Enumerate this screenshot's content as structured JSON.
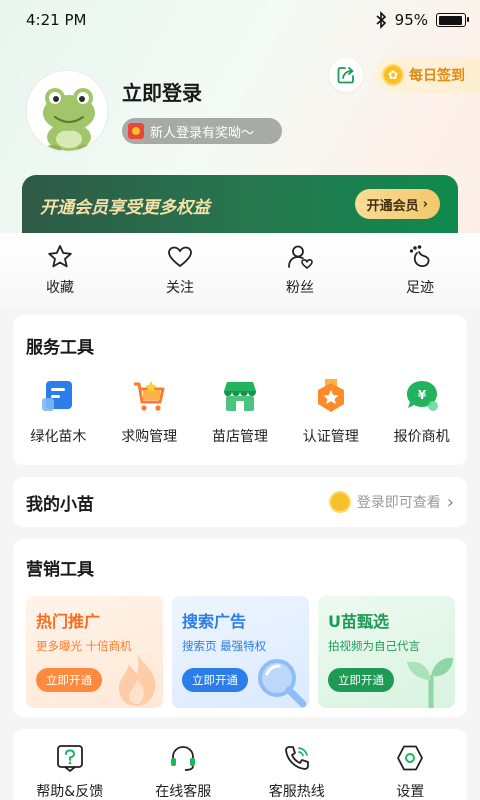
{
  "status_bar": {
    "time": "4:21 PM",
    "battery": "95%",
    "battery_level": 0.95
  },
  "header": {
    "checkin_label": "每日签到",
    "login_title": "立即登录",
    "newbie_reward": "新人登录有奖呦～"
  },
  "vip": {
    "banner_text": "开通会员享受更多权益",
    "button_label": "开通会员"
  },
  "quick": [
    {
      "label": "收藏"
    },
    {
      "label": "关注"
    },
    {
      "label": "粉丝"
    },
    {
      "label": "足迹"
    }
  ],
  "services": {
    "title": "服务工具",
    "items": [
      {
        "label": "绿化苗木"
      },
      {
        "label": "求购管理"
      },
      {
        "label": "苗店管理"
      },
      {
        "label": "认证管理"
      },
      {
        "label": "报价商机"
      }
    ]
  },
  "sprout": {
    "title": "我的小苗",
    "hint": "登录即可查看"
  },
  "marketing": {
    "title": "营销工具",
    "cards": [
      {
        "title": "热门推广",
        "subtitle": "更多曝光 十倍商机",
        "button": "立即开通"
      },
      {
        "title": "搜索广告",
        "subtitle": "搜索页 最强特权",
        "button": "立即开通"
      },
      {
        "title": "U苗甄选",
        "subtitle": "拍视频为自己代言",
        "button": "立即开通"
      }
    ]
  },
  "bottom_tools": [
    {
      "label": "帮助&反馈"
    },
    {
      "label": "在线客服"
    },
    {
      "label": "客服热线"
    },
    {
      "label": "设置"
    }
  ],
  "colors": {
    "brand_green": "#1f9a55",
    "accent_orange": "#ff7a2a",
    "accent_blue": "#2b7de9"
  }
}
